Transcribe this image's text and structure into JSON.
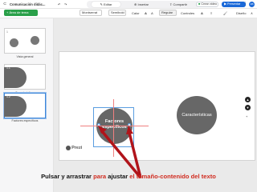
{
  "app": {
    "doc_title": "Comunicación didác...",
    "back_icon": "back-arrow-icon",
    "undo_icon": "undo-icon",
    "redo_icon": "redo-icon"
  },
  "mode_tabs": [
    {
      "label": "Editar",
      "icon": "pencil-icon",
      "active": true
    },
    {
      "label": "Insertar",
      "icon": "plus-circle-icon",
      "active": false
    },
    {
      "label": "Compartir",
      "icon": "share-icon",
      "active": false
    }
  ],
  "header_right": {
    "video_label": "Crear video",
    "present_label": "Presentar",
    "avatar_initials": "AB"
  },
  "toolbar": {
    "add_topic": "+ Área de tema",
    "font_family": "Montserrat",
    "font_weight": "Semibold",
    "size_label": "Calor",
    "bold": "A",
    "italic": "A",
    "case": "Regular",
    "list": "Controles",
    "color": "A",
    "style": "Diseño",
    "collapse": "∧"
  },
  "sidebar": {
    "slides": [
      {
        "num": "1",
        "label": "Vista general"
      },
      {
        "num": "1.1",
        "label": "Características"
      },
      {
        "num": "1.2",
        "label": "Factores específicos"
      }
    ]
  },
  "canvas": {
    "topic_factores": "Factores\nespecíficos",
    "topic_caracteristicas": "Características",
    "prezi_logo": "Prezi",
    "nav_up": "▲",
    "nav_down": "▼"
  },
  "caption": {
    "part1": "Pulsar y arrastrar",
    "part2": " para ",
    "part3": "ajustar",
    "part4": " el ",
    "part5": "tamaño-contenido",
    "part6": " del ",
    "part7": "texto"
  },
  "colors": {
    "accent_green": "#2aa04a",
    "accent_blue": "#1b69d8",
    "topic_gray": "#676767",
    "arrow_red": "#b0141a"
  }
}
